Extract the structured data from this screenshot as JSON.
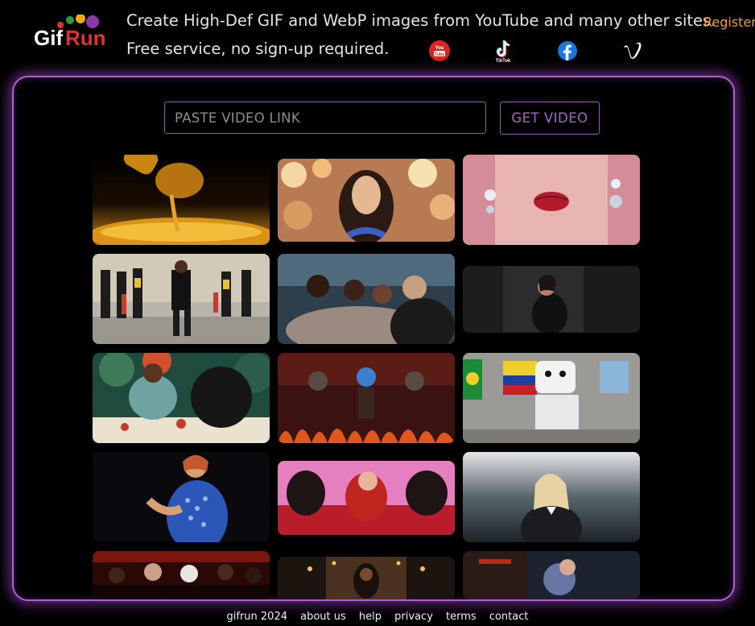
{
  "header": {
    "logo_text": "GifRun",
    "tagline_line1": "Create High-Def GIF and WebP images from YouTube and many other sites.",
    "tagline_line2": "Free service, no sign-up required.",
    "register_label": "Register",
    "social": [
      {
        "name": "youtube",
        "label": "You Tube"
      },
      {
        "name": "tiktok",
        "label": "TikTok"
      },
      {
        "name": "facebook",
        "label": ""
      },
      {
        "name": "vimeo",
        "label": ""
      }
    ]
  },
  "search": {
    "placeholder": "PASTE VIDEO LINK",
    "value": "",
    "button_label": "GET VIDEO"
  },
  "gallery": {
    "items": [
      {
        "name": "honey-dipper"
      },
      {
        "name": "woman-sparkle-lights"
      },
      {
        "name": "red-lips-closeup"
      },
      {
        "name": "marching-band-dancer"
      },
      {
        "name": "group-selfie-party"
      },
      {
        "name": "woman-in-black-dress"
      },
      {
        "name": "colorful-dinner-table"
      },
      {
        "name": "stage-dancers-fire"
      },
      {
        "name": "marshmello-flags"
      },
      {
        "name": "woman-blue-dress"
      },
      {
        "name": "red-hair-dancers"
      },
      {
        "name": "blonde-woman-suit"
      },
      {
        "name": "crowd-night-party"
      },
      {
        "name": "candlelit-room"
      },
      {
        "name": "blue-haze-portrait"
      }
    ]
  },
  "footer": {
    "copyright": "gifrun 2024",
    "links": [
      "about us",
      "help",
      "privacy",
      "terms",
      "contact"
    ]
  },
  "colors": {
    "accent": "#b05fd1",
    "register": "#e8a030",
    "background": "#000000"
  }
}
